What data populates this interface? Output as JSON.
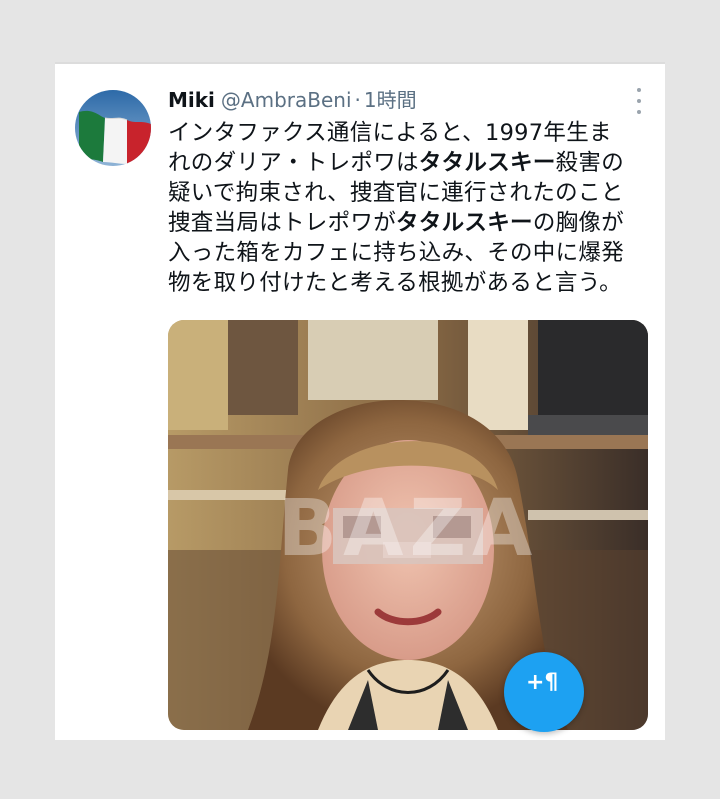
{
  "tweet": {
    "display_name": "Miki",
    "handle": "@AmbraBeni",
    "separator": "·",
    "time": "1時間",
    "text_lines": [
      [
        "インタファクス通信によると、1997年生ま",
        "",
        ""
      ],
      [
        "れのダリア・トレポワは",
        "タタルスキー",
        "殺害の"
      ],
      [
        "疑いで拘束され、捜査官に連行されたのこと",
        "",
        ""
      ],
      [
        "捜査当局はトレポワが",
        "タタルスキー",
        "の胸像が"
      ],
      [
        "入った箱をカフェに持ち込み、その中に爆発",
        "",
        ""
      ],
      [
        "物を取り付けたと考える根拠があると言う。",
        "",
        ""
      ]
    ],
    "photo_watermark": "BAZA"
  },
  "icons": {
    "avatar": "italian-flag-avatar",
    "more": "more-vertical-icon",
    "compose": "compose-tweet-icon"
  },
  "colors": {
    "accent": "#1da1f2",
    "secondary_text": "#5b7083",
    "primary_text": "#0f1419"
  }
}
